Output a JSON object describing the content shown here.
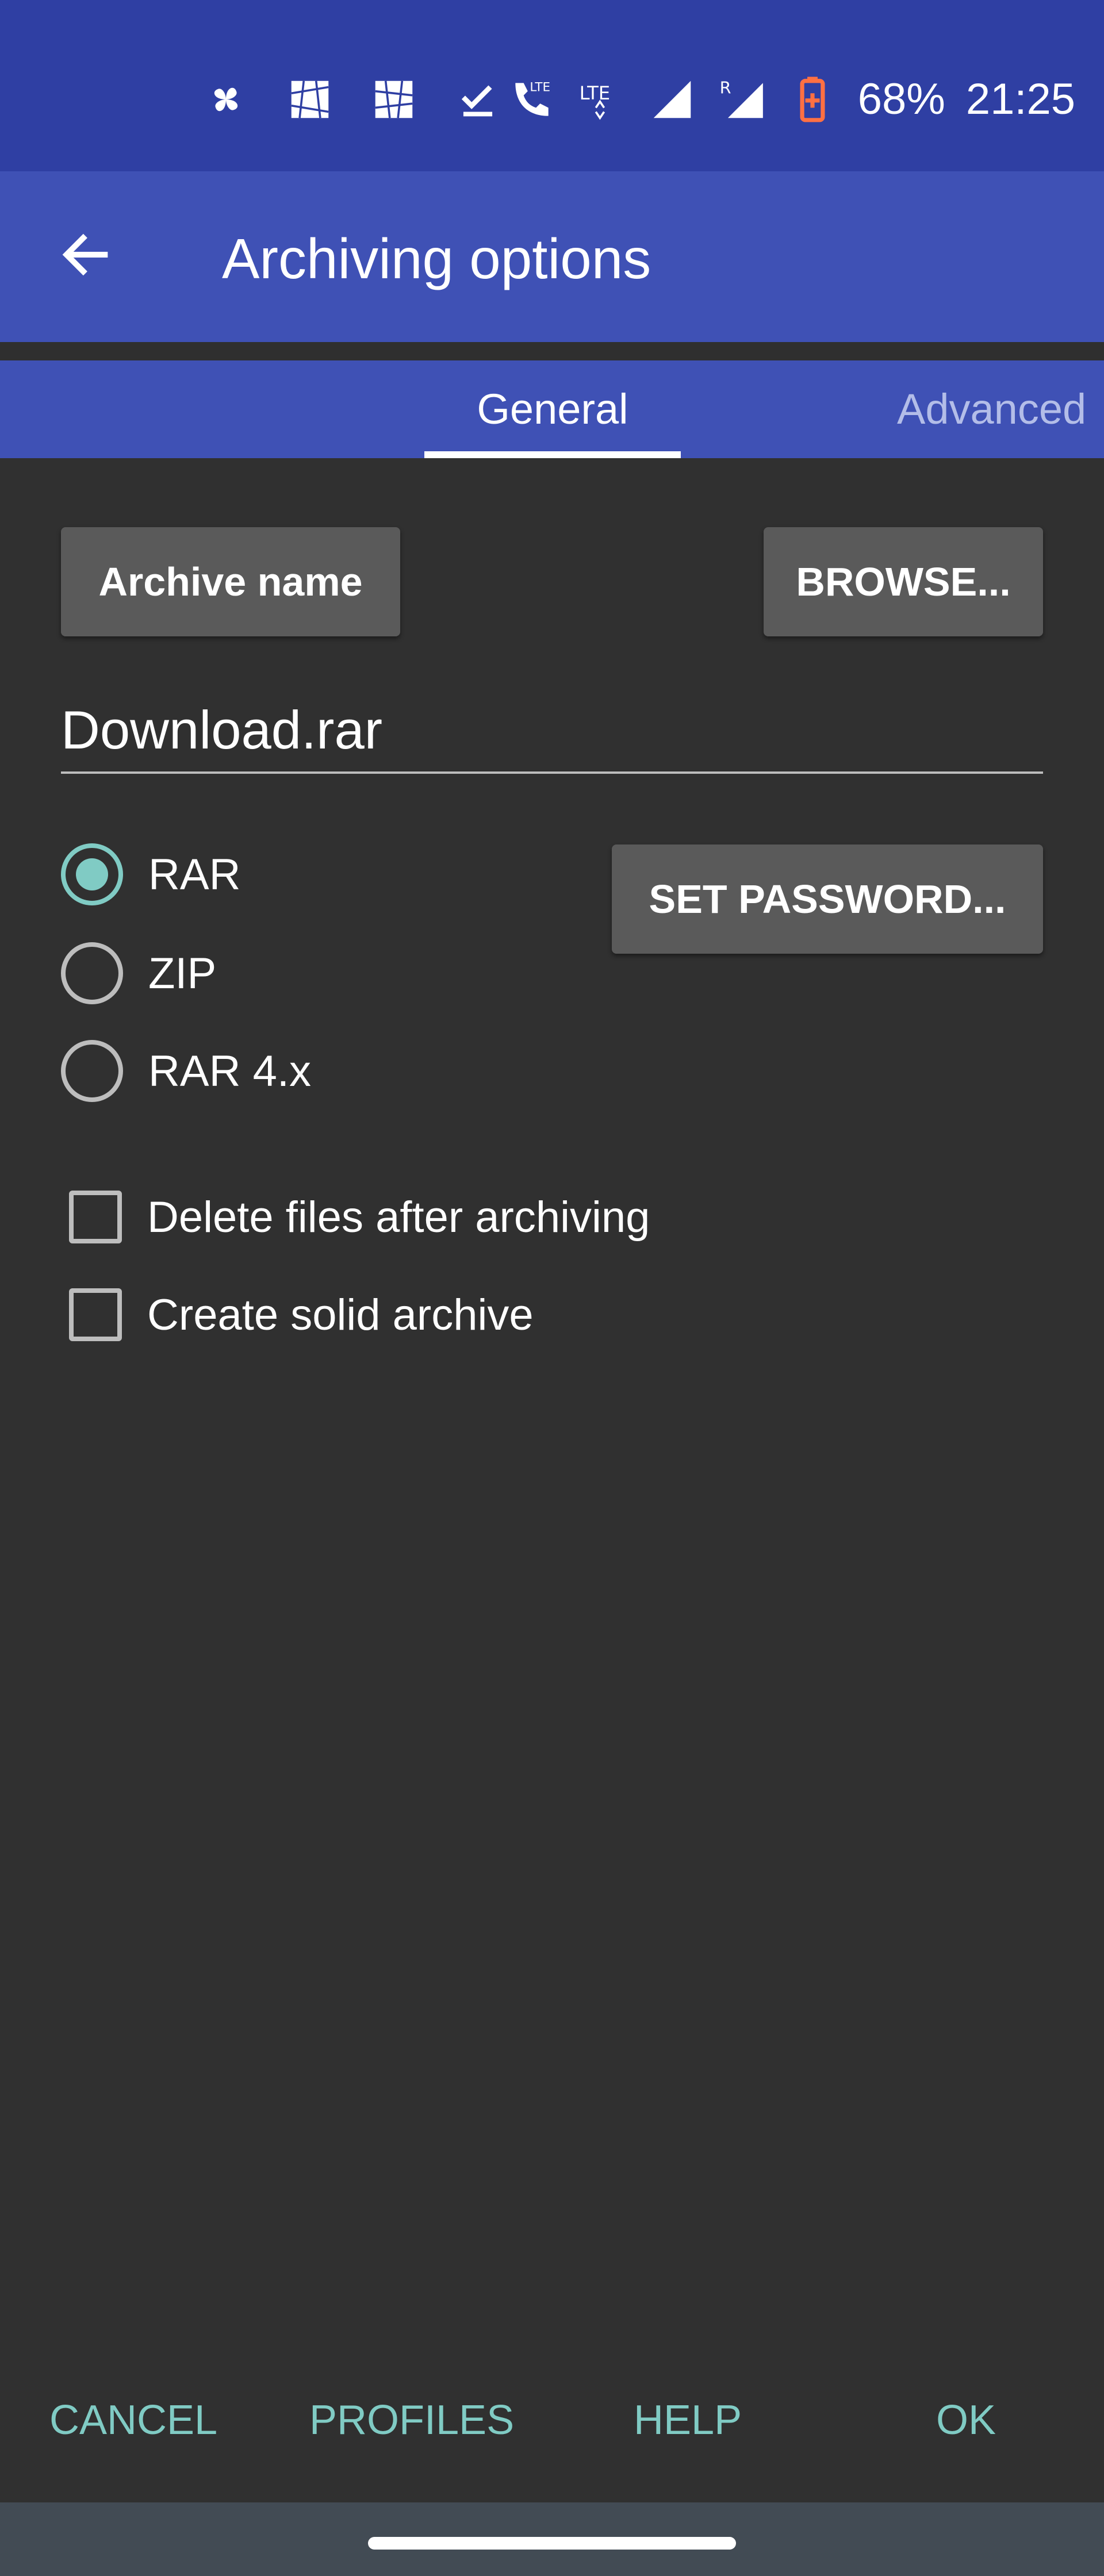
{
  "status_bar": {
    "battery": "68%",
    "time": "21:25",
    "left_icons": [
      "pinwheel-icon",
      "photo-icon",
      "photo-icon",
      "checkmark-icon"
    ],
    "right_icons": [
      "volte-call-icon",
      "lte-icon",
      "signal-icon",
      "roaming-signal-icon",
      "battery-saver-icon"
    ]
  },
  "app_bar": {
    "title": "Archiving options",
    "back_icon": "arrow-left-icon"
  },
  "tabs": [
    {
      "label": "General",
      "selected": true
    },
    {
      "label": "Advanced",
      "selected": false
    }
  ],
  "form": {
    "archive_name_button": "Archive name",
    "browse_button": "BROWSE...",
    "archive_name_value": "Download.rar",
    "set_password_button": "SET PASSWORD...",
    "formats": [
      {
        "label": "RAR",
        "checked": true
      },
      {
        "label": "ZIP",
        "checked": false
      },
      {
        "label": "RAR 4.x",
        "checked": false
      }
    ],
    "options": [
      {
        "label": "Delete files after archiving",
        "checked": false
      },
      {
        "label": "Create solid archive",
        "checked": false
      }
    ]
  },
  "actions": {
    "cancel": "CANCEL",
    "profiles": "PROFILES",
    "help": "HELP",
    "ok": "OK"
  },
  "colors": {
    "status_bar": "#2f3fa3",
    "primary": "#3f51b5",
    "background": "#303030",
    "accent": "#80cbc4",
    "button": "#5a5a5a"
  }
}
